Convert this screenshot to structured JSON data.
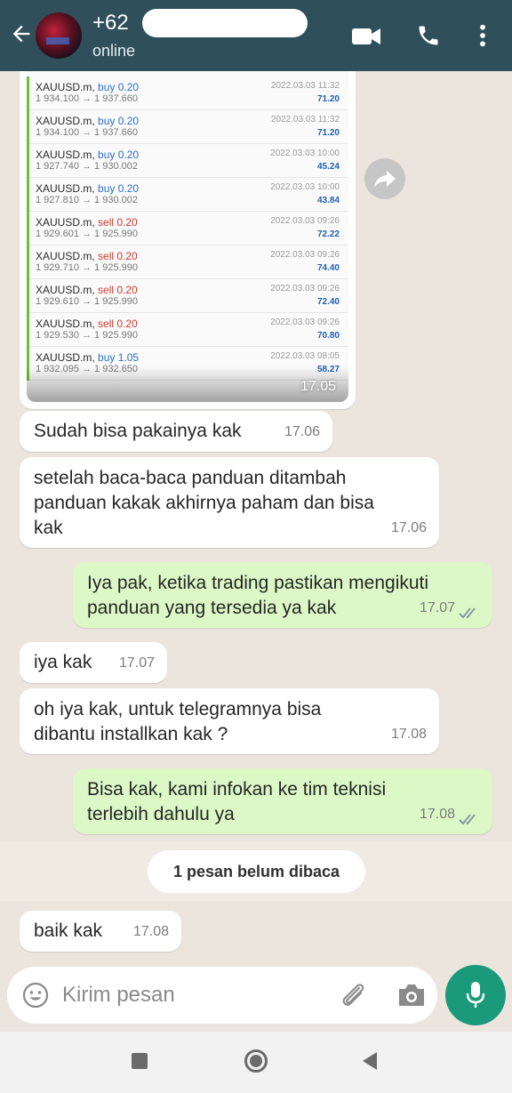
{
  "header": {
    "contact_name": "+62",
    "status": "online"
  },
  "trades": [
    {
      "symbol": "XAUUSD.m,",
      "side": "buy 0.20",
      "type": "buy",
      "prices": "1 934.100 → 1 937.660",
      "date": "2022.03.03 11:32",
      "profit": "71.20"
    },
    {
      "symbol": "XAUUSD.m,",
      "side": "buy 0.20",
      "type": "buy",
      "prices": "1 934.100 → 1 937.660",
      "date": "2022.03.03 11:32",
      "profit": "71.20"
    },
    {
      "symbol": "XAUUSD.m,",
      "side": "buy 0.20",
      "type": "buy",
      "prices": "1 927.740 → 1 930.002",
      "date": "2022.03.03 10:00",
      "profit": "45.24"
    },
    {
      "symbol": "XAUUSD.m,",
      "side": "buy 0.20",
      "type": "buy",
      "prices": "1 927.810 → 1 930.002",
      "date": "2022.03.03 10:00",
      "profit": "43.84"
    },
    {
      "symbol": "XAUUSD.m,",
      "side": "sell 0.20",
      "type": "sell",
      "prices": "1 929.601 → 1 925.990",
      "date": "2022.03.03 09:26",
      "profit": "72.22"
    },
    {
      "symbol": "XAUUSD.m,",
      "side": "sell 0.20",
      "type": "sell",
      "prices": "1 929.710 → 1 925.990",
      "date": "2022.03.03 09:26",
      "profit": "74.40"
    },
    {
      "symbol": "XAUUSD.m,",
      "side": "sell 0.20",
      "type": "sell",
      "prices": "1 929.610 → 1 925.990",
      "date": "2022.03.03 09:26",
      "profit": "72.40"
    },
    {
      "symbol": "XAUUSD.m,",
      "side": "sell 0.20",
      "type": "sell",
      "prices": "1 929.530 → 1 925.990",
      "date": "2022.03.03 09:26",
      "profit": "70.80"
    },
    {
      "symbol": "XAUUSD.m,",
      "side": "buy 1.05",
      "type": "buy",
      "prices": "1 932.095 → 1 932.650",
      "date": "2022.03.03 08:05",
      "profit": "58.27"
    }
  ],
  "image_time": "17.05",
  "messages": {
    "m1": {
      "text": "Sudah bisa pakainya kak",
      "time": "17.06"
    },
    "m2": {
      "line1": "setelah baca-baca panduan ditambah",
      "line2": "panduan kakak akhirnya paham dan bisa",
      "line3": "kak",
      "time": "17.06"
    },
    "m3": {
      "line1": "Iya pak, ketika trading pastikan mengikuti",
      "line2": "panduan yang tersedia ya kak",
      "time": "17.07"
    },
    "m4": {
      "text": "iya kak",
      "time": "17.07"
    },
    "m5": {
      "line1": "oh iya kak, untuk telegramnya bisa",
      "line2": "dibantu installkan kak ?",
      "time": "17.08"
    },
    "m6": {
      "line1": "Bisa kak, kami infokan ke tim teknisi",
      "line2": "terlebih dahulu ya",
      "time": "17.08"
    },
    "m7": {
      "text": "baik kak",
      "time": "17.08"
    }
  },
  "unread_label": "1 pesan belum dibaca",
  "input": {
    "placeholder": "Kirim pesan"
  },
  "colors": {
    "header": "#2f4f5b",
    "chat_bg": "#ece5dd",
    "outgoing": "#dcf8c6",
    "mic": "#1a9a7a",
    "read_check": "#7b8fa0"
  }
}
